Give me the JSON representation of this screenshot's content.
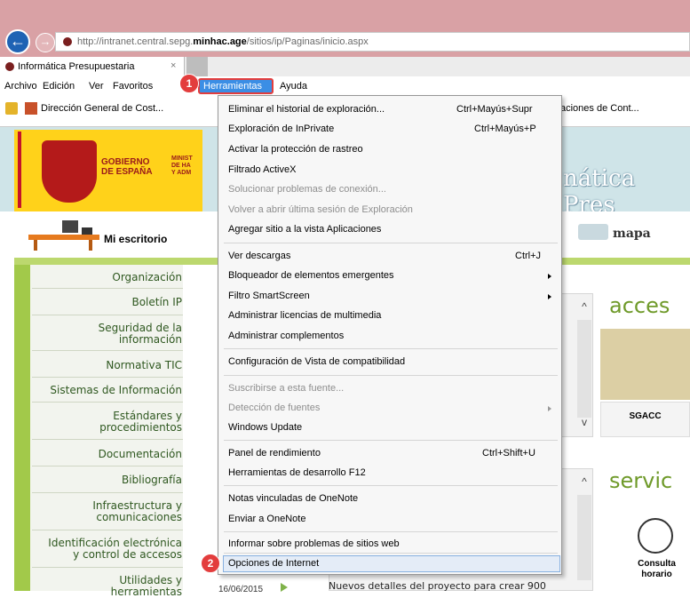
{
  "browser": {
    "url_prefix": "http://intranet.central.sepg.",
    "url_domain": "minhac.age",
    "url_suffix": "/sitios/ip/Paginas/inicio.aspx",
    "tab_title": "Informática Presupuestaria",
    "tab_close": "×",
    "back_glyph": "←",
    "forward_glyph": "→"
  },
  "menubar": {
    "archivo": "Archivo",
    "edicion": "Edición",
    "ver": "Ver",
    "favoritos": "Favoritos",
    "herramientas": "Herramientas",
    "ayuda": "Ayuda"
  },
  "favorites": {
    "item1": "Dirección General de Cost...",
    "item2": "aciones de Cont..."
  },
  "page": {
    "gobierno": "GOBIERNO",
    "de_espana": "DE ESPAÑA",
    "minis_1": "MINIST",
    "minis_2": "DE HA",
    "minis_3": "Y ADM",
    "big_title": "nática Pres",
    "mi_escritorio": "Mi escritorio",
    "mapa": "mapa",
    "nav": [
      "Organización",
      "Boletín IP",
      "Seguridad de la",
      "información",
      "Normativa TIC",
      "Sistemas de Información",
      "Estándares y",
      "procedimientos",
      "Documentación",
      "Bibliografía",
      "Infraestructura y",
      "comunicaciones",
      "Identificación electrónica",
      "y control de accesos",
      "Utilidades y",
      "herramientas"
    ],
    "acceso": "acces",
    "sgacc": "SGACC",
    "servic": "servic",
    "consulta_1": "Consulta",
    "consulta_2": "horario",
    "news_text": "Nuevos detalles del proyecto para crear 900",
    "news_date": "16/06/2015",
    "scroll_up": "^",
    "scroll_down": "v"
  },
  "dropdown": {
    "items": [
      {
        "label": "Eliminar el historial de exploración...",
        "shortcut": "Ctrl+Mayús+Supr"
      },
      {
        "label": "Exploración de InPrivate",
        "shortcut": "Ctrl+Mayús+P"
      },
      {
        "label": "Activar la protección de rastreo",
        "shortcut": ""
      },
      {
        "label": "Filtrado ActiveX",
        "shortcut": ""
      },
      {
        "label": "Solucionar problemas de conexión...",
        "shortcut": ""
      },
      {
        "label": "Volver a abrir última sesión de Exploración",
        "shortcut": ""
      },
      {
        "label": "Agregar sitio a la vista Aplicaciones",
        "shortcut": ""
      },
      {
        "label": "Ver descargas",
        "shortcut": "Ctrl+J"
      },
      {
        "label": "Bloqueador de elementos emergentes",
        "shortcut": ""
      },
      {
        "label": "Filtro SmartScreen",
        "shortcut": ""
      },
      {
        "label": "Administrar licencias de multimedia",
        "shortcut": ""
      },
      {
        "label": "Administrar complementos",
        "shortcut": ""
      },
      {
        "label": "Configuración de Vista de compatibilidad",
        "shortcut": ""
      },
      {
        "label": "Suscribirse a esta fuente...",
        "shortcut": ""
      },
      {
        "label": "Detección de fuentes",
        "shortcut": ""
      },
      {
        "label": "Windows Update",
        "shortcut": ""
      },
      {
        "label": "Panel de rendimiento",
        "shortcut": "Ctrl+Shift+U"
      },
      {
        "label": "Herramientas de desarrollo F12",
        "shortcut": ""
      },
      {
        "label": "Notas vinculadas de OneNote",
        "shortcut": ""
      },
      {
        "label": "Enviar a OneNote",
        "shortcut": ""
      },
      {
        "label": "Informar sobre problemas de sitios web",
        "shortcut": ""
      },
      {
        "label": "Opciones de Internet",
        "shortcut": ""
      }
    ]
  },
  "badges": {
    "step1": "1",
    "step2": "2"
  },
  "colors": {
    "browser_frame": "#d9a1a5",
    "menu_highlight": "#3b8ee5",
    "badge": "#e33d3d",
    "nav_green": "#a2c94a"
  }
}
